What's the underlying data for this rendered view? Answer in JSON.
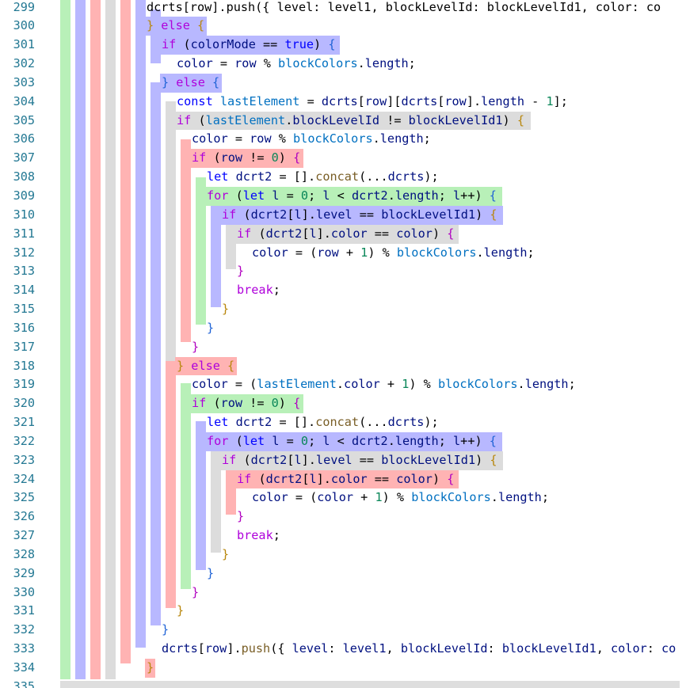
{
  "editor": {
    "language": "javascript",
    "first_line": 299,
    "line_numbers": [
      "299",
      "300",
      "301",
      "302",
      "303",
      "304",
      "305",
      "306",
      "307",
      "308",
      "309",
      "310",
      "311",
      "312",
      "313",
      "314",
      "315",
      "316",
      "317",
      "318",
      "319",
      "320",
      "321",
      "322",
      "323",
      "324",
      "325",
      "326",
      "327",
      "328",
      "329",
      "330",
      "331",
      "332",
      "333",
      "334",
      "335"
    ],
    "colors": {
      "line_number": "#237893",
      "keyword": "#0000ff",
      "control": "#af00db",
      "identifier": "#001080",
      "variable": "#0070c1",
      "number": "#098658",
      "function": "#795e26",
      "bracket_gold": "#b8860b",
      "bracket_purple": "#b000c0",
      "bracket_blue": "#1f63d6",
      "guide_green": "#b8f0b8",
      "guide_blue": "#b8b8ff",
      "guide_red": "#ffb3b3",
      "guide_gray": "#dcdcdc"
    },
    "lines": [
      [
        {
          "t": "dcrts[row].push({ level: level1, blockLevelId: blockLevelId1, color: co",
          "c": "#000000"
        }
      ],
      [
        {
          "t": "}",
          "c": "#b8860b"
        },
        {
          "t": " else ",
          "c": "#af00db"
        },
        {
          "t": "{",
          "c": "#b8860b"
        }
      ],
      [
        {
          "t": "if",
          "c": "#af00db"
        },
        {
          "t": " (",
          "c": "#000000"
        },
        {
          "t": "colorMode",
          "c": "#001080"
        },
        {
          "t": " == ",
          "c": "#000000"
        },
        {
          "t": "true",
          "c": "#0000ff"
        },
        {
          "t": ") ",
          "c": "#000000"
        },
        {
          "t": "{",
          "c": "#1f63d6"
        }
      ],
      [
        {
          "t": "color",
          "c": "#001080"
        },
        {
          "t": " = ",
          "c": "#000000"
        },
        {
          "t": "row",
          "c": "#001080"
        },
        {
          "t": " % ",
          "c": "#000000"
        },
        {
          "t": "blockColors",
          "c": "#0070c1"
        },
        {
          "t": ".",
          "c": "#000000"
        },
        {
          "t": "length",
          "c": "#001080"
        },
        {
          "t": ";",
          "c": "#000000"
        }
      ],
      [
        {
          "t": "}",
          "c": "#1f63d6"
        },
        {
          "t": " else ",
          "c": "#af00db"
        },
        {
          "t": "{",
          "c": "#1f63d6"
        }
      ],
      [
        {
          "t": "const",
          "c": "#0000ff"
        },
        {
          "t": " ",
          "c": "#000000"
        },
        {
          "t": "lastElement",
          "c": "#0070c1"
        },
        {
          "t": " = ",
          "c": "#000000"
        },
        {
          "t": "dcrts",
          "c": "#001080"
        },
        {
          "t": "[",
          "c": "#000000"
        },
        {
          "t": "row",
          "c": "#001080"
        },
        {
          "t": "][",
          "c": "#000000"
        },
        {
          "t": "dcrts",
          "c": "#001080"
        },
        {
          "t": "[",
          "c": "#000000"
        },
        {
          "t": "row",
          "c": "#001080"
        },
        {
          "t": "].",
          "c": "#000000"
        },
        {
          "t": "length",
          "c": "#001080"
        },
        {
          "t": " - ",
          "c": "#000000"
        },
        {
          "t": "1",
          "c": "#098658"
        },
        {
          "t": "];",
          "c": "#000000"
        }
      ],
      [
        {
          "t": "if",
          "c": "#af00db"
        },
        {
          "t": " (",
          "c": "#000000"
        },
        {
          "t": "lastElement",
          "c": "#0070c1"
        },
        {
          "t": ".",
          "c": "#000000"
        },
        {
          "t": "blockLevelId",
          "c": "#001080"
        },
        {
          "t": " != ",
          "c": "#000000"
        },
        {
          "t": "blockLevelId1",
          "c": "#001080"
        },
        {
          "t": ") ",
          "c": "#000000"
        },
        {
          "t": "{",
          "c": "#b8860b"
        }
      ],
      [
        {
          "t": "color",
          "c": "#001080"
        },
        {
          "t": " = ",
          "c": "#000000"
        },
        {
          "t": "row",
          "c": "#001080"
        },
        {
          "t": " % ",
          "c": "#000000"
        },
        {
          "t": "blockColors",
          "c": "#0070c1"
        },
        {
          "t": ".",
          "c": "#000000"
        },
        {
          "t": "length",
          "c": "#001080"
        },
        {
          "t": ";",
          "c": "#000000"
        }
      ],
      [
        {
          "t": "if",
          "c": "#af00db"
        },
        {
          "t": " (",
          "c": "#000000"
        },
        {
          "t": "row",
          "c": "#001080"
        },
        {
          "t": " != ",
          "c": "#000000"
        },
        {
          "t": "0",
          "c": "#098658"
        },
        {
          "t": ") ",
          "c": "#000000"
        },
        {
          "t": "{",
          "c": "#b000c0"
        }
      ],
      [
        {
          "t": "let",
          "c": "#0000ff"
        },
        {
          "t": " ",
          "c": "#000000"
        },
        {
          "t": "dcrt2",
          "c": "#001080"
        },
        {
          "t": " = [].",
          "c": "#000000"
        },
        {
          "t": "concat",
          "c": "#795e26"
        },
        {
          "t": "(...",
          "c": "#000000"
        },
        {
          "t": "dcrts",
          "c": "#001080"
        },
        {
          "t": ");",
          "c": "#000000"
        }
      ],
      [
        {
          "t": "for",
          "c": "#af00db"
        },
        {
          "t": " (",
          "c": "#000000"
        },
        {
          "t": "let",
          "c": "#0000ff"
        },
        {
          "t": " ",
          "c": "#000000"
        },
        {
          "t": "l",
          "c": "#001080"
        },
        {
          "t": " = ",
          "c": "#000000"
        },
        {
          "t": "0",
          "c": "#098658"
        },
        {
          "t": "; ",
          "c": "#000000"
        },
        {
          "t": "l",
          "c": "#001080"
        },
        {
          "t": " < ",
          "c": "#000000"
        },
        {
          "t": "dcrt2",
          "c": "#001080"
        },
        {
          "t": ".",
          "c": "#000000"
        },
        {
          "t": "length",
          "c": "#001080"
        },
        {
          "t": "; ",
          "c": "#000000"
        },
        {
          "t": "l",
          "c": "#001080"
        },
        {
          "t": "++) ",
          "c": "#000000"
        },
        {
          "t": "{",
          "c": "#1f63d6"
        }
      ],
      [
        {
          "t": "if",
          "c": "#af00db"
        },
        {
          "t": " (",
          "c": "#000000"
        },
        {
          "t": "dcrt2",
          "c": "#001080"
        },
        {
          "t": "[",
          "c": "#000000"
        },
        {
          "t": "l",
          "c": "#001080"
        },
        {
          "t": "].",
          "c": "#000000"
        },
        {
          "t": "level",
          "c": "#001080"
        },
        {
          "t": " == ",
          "c": "#000000"
        },
        {
          "t": "blockLevelId1",
          "c": "#001080"
        },
        {
          "t": ") ",
          "c": "#000000"
        },
        {
          "t": "{",
          "c": "#b8860b"
        }
      ],
      [
        {
          "t": "if",
          "c": "#af00db"
        },
        {
          "t": " (",
          "c": "#000000"
        },
        {
          "t": "dcrt2",
          "c": "#001080"
        },
        {
          "t": "[",
          "c": "#000000"
        },
        {
          "t": "l",
          "c": "#001080"
        },
        {
          "t": "].",
          "c": "#000000"
        },
        {
          "t": "color",
          "c": "#001080"
        },
        {
          "t": " == ",
          "c": "#000000"
        },
        {
          "t": "color",
          "c": "#001080"
        },
        {
          "t": ") ",
          "c": "#000000"
        },
        {
          "t": "{",
          "c": "#b000c0"
        }
      ],
      [
        {
          "t": "color",
          "c": "#001080"
        },
        {
          "t": " = (",
          "c": "#000000"
        },
        {
          "t": "row",
          "c": "#001080"
        },
        {
          "t": " + ",
          "c": "#000000"
        },
        {
          "t": "1",
          "c": "#098658"
        },
        {
          "t": ") % ",
          "c": "#000000"
        },
        {
          "t": "blockColors",
          "c": "#0070c1"
        },
        {
          "t": ".",
          "c": "#000000"
        },
        {
          "t": "length",
          "c": "#001080"
        },
        {
          "t": ";",
          "c": "#000000"
        }
      ],
      [
        {
          "t": "}",
          "c": "#b000c0"
        }
      ],
      [
        {
          "t": "break",
          "c": "#af00db"
        },
        {
          "t": ";",
          "c": "#000000"
        }
      ],
      [
        {
          "t": "}",
          "c": "#b8860b"
        }
      ],
      [
        {
          "t": "}",
          "c": "#1f63d6"
        }
      ],
      [
        {
          "t": "}",
          "c": "#b000c0"
        }
      ],
      [
        {
          "t": "}",
          "c": "#b8860b"
        },
        {
          "t": " else ",
          "c": "#af00db"
        },
        {
          "t": "{",
          "c": "#b8860b"
        }
      ],
      [
        {
          "t": "color",
          "c": "#001080"
        },
        {
          "t": " = (",
          "c": "#000000"
        },
        {
          "t": "lastElement",
          "c": "#0070c1"
        },
        {
          "t": ".",
          "c": "#000000"
        },
        {
          "t": "color",
          "c": "#001080"
        },
        {
          "t": " + ",
          "c": "#000000"
        },
        {
          "t": "1",
          "c": "#098658"
        },
        {
          "t": ") % ",
          "c": "#000000"
        },
        {
          "t": "blockColors",
          "c": "#0070c1"
        },
        {
          "t": ".",
          "c": "#000000"
        },
        {
          "t": "length",
          "c": "#001080"
        },
        {
          "t": ";",
          "c": "#000000"
        }
      ],
      [
        {
          "t": "if",
          "c": "#af00db"
        },
        {
          "t": " (",
          "c": "#000000"
        },
        {
          "t": "row",
          "c": "#001080"
        },
        {
          "t": " != ",
          "c": "#000000"
        },
        {
          "t": "0",
          "c": "#098658"
        },
        {
          "t": ") ",
          "c": "#000000"
        },
        {
          "t": "{",
          "c": "#b000c0"
        }
      ],
      [
        {
          "t": "let",
          "c": "#0000ff"
        },
        {
          "t": " ",
          "c": "#000000"
        },
        {
          "t": "dcrt2",
          "c": "#001080"
        },
        {
          "t": " = [].",
          "c": "#000000"
        },
        {
          "t": "concat",
          "c": "#795e26"
        },
        {
          "t": "(...",
          "c": "#000000"
        },
        {
          "t": "dcrts",
          "c": "#001080"
        },
        {
          "t": ");",
          "c": "#000000"
        }
      ],
      [
        {
          "t": "for",
          "c": "#af00db"
        },
        {
          "t": " (",
          "c": "#000000"
        },
        {
          "t": "let",
          "c": "#0000ff"
        },
        {
          "t": " ",
          "c": "#000000"
        },
        {
          "t": "l",
          "c": "#001080"
        },
        {
          "t": " = ",
          "c": "#000000"
        },
        {
          "t": "0",
          "c": "#098658"
        },
        {
          "t": "; ",
          "c": "#000000"
        },
        {
          "t": "l",
          "c": "#001080"
        },
        {
          "t": " < ",
          "c": "#000000"
        },
        {
          "t": "dcrt2",
          "c": "#001080"
        },
        {
          "t": ".",
          "c": "#000000"
        },
        {
          "t": "length",
          "c": "#001080"
        },
        {
          "t": "; ",
          "c": "#000000"
        },
        {
          "t": "l",
          "c": "#001080"
        },
        {
          "t": "++) ",
          "c": "#000000"
        },
        {
          "t": "{",
          "c": "#1f63d6"
        }
      ],
      [
        {
          "t": "if",
          "c": "#af00db"
        },
        {
          "t": " (",
          "c": "#000000"
        },
        {
          "t": "dcrt2",
          "c": "#001080"
        },
        {
          "t": "[",
          "c": "#000000"
        },
        {
          "t": "l",
          "c": "#001080"
        },
        {
          "t": "].",
          "c": "#000000"
        },
        {
          "t": "level",
          "c": "#001080"
        },
        {
          "t": " == ",
          "c": "#000000"
        },
        {
          "t": "blockLevelId1",
          "c": "#001080"
        },
        {
          "t": ") ",
          "c": "#000000"
        },
        {
          "t": "{",
          "c": "#b8860b"
        }
      ],
      [
        {
          "t": "if",
          "c": "#af00db"
        },
        {
          "t": " (",
          "c": "#000000"
        },
        {
          "t": "dcrt2",
          "c": "#001080"
        },
        {
          "t": "[",
          "c": "#000000"
        },
        {
          "t": "l",
          "c": "#001080"
        },
        {
          "t": "].",
          "c": "#000000"
        },
        {
          "t": "color",
          "c": "#001080"
        },
        {
          "t": " == ",
          "c": "#000000"
        },
        {
          "t": "color",
          "c": "#001080"
        },
        {
          "t": ") ",
          "c": "#000000"
        },
        {
          "t": "{",
          "c": "#b000c0"
        }
      ],
      [
        {
          "t": "color",
          "c": "#001080"
        },
        {
          "t": " = (",
          "c": "#000000"
        },
        {
          "t": "color",
          "c": "#001080"
        },
        {
          "t": " + ",
          "c": "#000000"
        },
        {
          "t": "1",
          "c": "#098658"
        },
        {
          "t": ") % ",
          "c": "#000000"
        },
        {
          "t": "blockColors",
          "c": "#0070c1"
        },
        {
          "t": ".",
          "c": "#000000"
        },
        {
          "t": "length",
          "c": "#001080"
        },
        {
          "t": ";",
          "c": "#000000"
        }
      ],
      [
        {
          "t": "}",
          "c": "#b000c0"
        }
      ],
      [
        {
          "t": "break",
          "c": "#af00db"
        },
        {
          "t": ";",
          "c": "#000000"
        }
      ],
      [
        {
          "t": "}",
          "c": "#b8860b"
        }
      ],
      [
        {
          "t": "}",
          "c": "#1f63d6"
        }
      ],
      [
        {
          "t": "}",
          "c": "#b000c0"
        }
      ],
      [
        {
          "t": "}",
          "c": "#b8860b"
        }
      ],
      [
        {
          "t": "}",
          "c": "#1f63d6"
        }
      ],
      [
        {
          "t": "dcrts",
          "c": "#001080"
        },
        {
          "t": "[",
          "c": "#000000"
        },
        {
          "t": "row",
          "c": "#001080"
        },
        {
          "t": "].",
          "c": "#000000"
        },
        {
          "t": "push",
          "c": "#795e26"
        },
        {
          "t": "({ ",
          "c": "#000000"
        },
        {
          "t": "level",
          "c": "#001080"
        },
        {
          "t": ": ",
          "c": "#000000"
        },
        {
          "t": "level1",
          "c": "#001080"
        },
        {
          "t": ", ",
          "c": "#000000"
        },
        {
          "t": "blockLevelId",
          "c": "#001080"
        },
        {
          "t": ": ",
          "c": "#000000"
        },
        {
          "t": "blockLevelId1",
          "c": "#001080"
        },
        {
          "t": ", ",
          "c": "#000000"
        },
        {
          "t": "color",
          "c": "#001080"
        },
        {
          "t": ": ",
          "c": "#000000"
        },
        {
          "t": "co",
          "c": "#001080"
        }
      ],
      [
        {
          "t": "}",
          "c": "#b8860b"
        }
      ],
      [
        {
          "t": "}",
          "c": "#b8860b"
        }
      ]
    ]
  }
}
